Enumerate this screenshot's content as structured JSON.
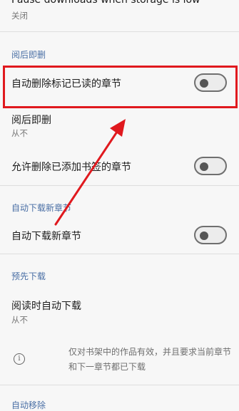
{
  "top_item": {
    "title": "Pause downloads when storage is low",
    "value": "关闭"
  },
  "section_read_delete": {
    "header": "阅后即删"
  },
  "auto_delete_read": {
    "label": "自动删除标记已读的章节",
    "enabled": false
  },
  "read_delete": {
    "title": "阅后即删",
    "value": "从不"
  },
  "allow_delete_bookmarked": {
    "label": "允许删除已添加书签的章节",
    "enabled": false
  },
  "section_auto_download": {
    "header": "自动下载新章节"
  },
  "auto_download_new": {
    "label": "自动下载新章节",
    "enabled": false
  },
  "section_preload": {
    "header": "预先下载"
  },
  "preload_while_reading": {
    "title": "阅读时自动下载",
    "value": "从不"
  },
  "info_note": {
    "line1": "仅对书架中的作品有效，并且要求当前章节",
    "line2": "和下一章节都已下载",
    "icon": "info-icon"
  },
  "section_auto_remove": {
    "header": "自动移除"
  },
  "annotation": {
    "color": "#e0191e"
  }
}
